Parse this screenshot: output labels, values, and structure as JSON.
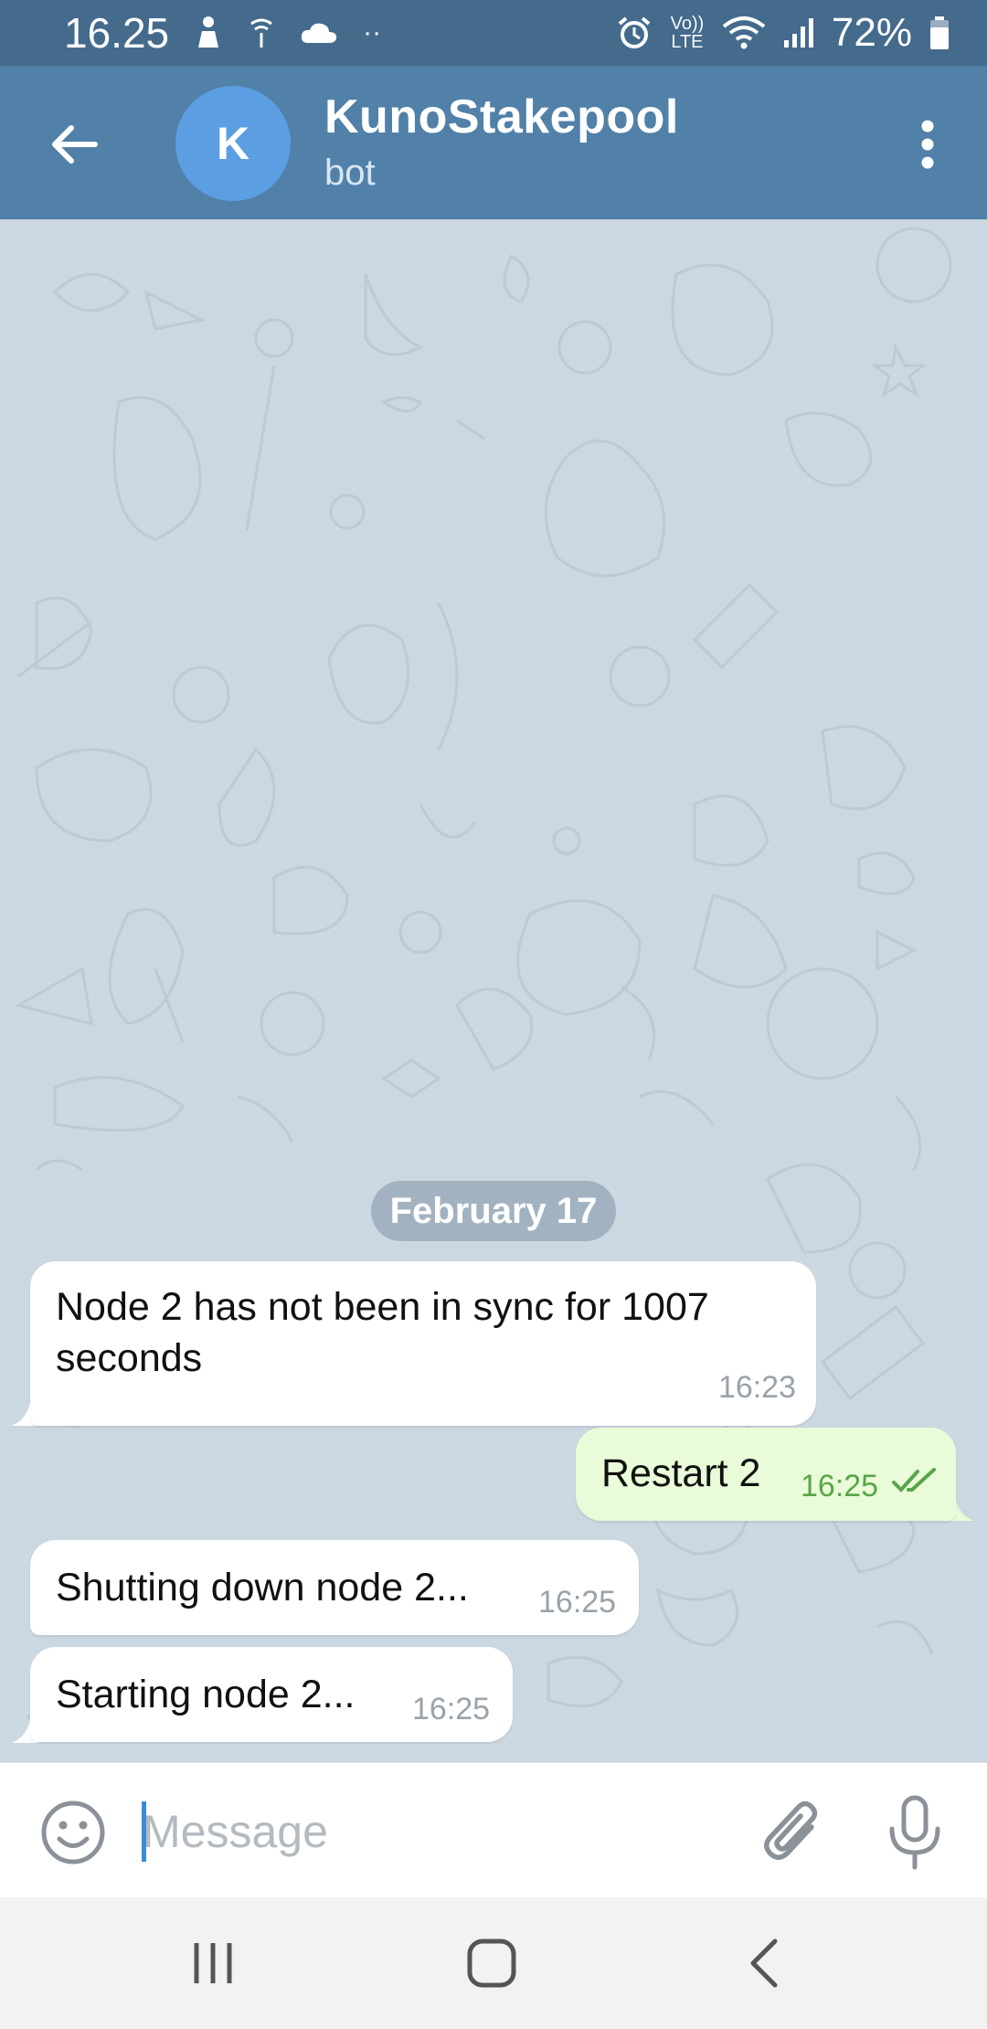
{
  "status_bar": {
    "time": "16.25",
    "notification_dots": "··",
    "volte_label": "Vo)) LTE",
    "battery": "72%"
  },
  "header": {
    "avatar_letter": "K",
    "title": "KunoStakepool",
    "subtitle": "bot"
  },
  "chat": {
    "date_separator": "February 17",
    "messages": [
      {
        "direction": "in",
        "text_line1": "Node 2 has not been in sync for 1007",
        "text_line2": "seconds",
        "time": "16:23"
      },
      {
        "direction": "out",
        "text": "Restart 2",
        "time": "16:25",
        "status": "read"
      },
      {
        "direction": "in",
        "text": "Shutting down node 2...",
        "time": "16:25"
      },
      {
        "direction": "in",
        "text": "Starting node 2...",
        "time": "16:25"
      }
    ]
  },
  "input": {
    "placeholder": "Message"
  },
  "colors": {
    "status_bar": "#446a8c",
    "header": "#5180a8",
    "avatar": "#5c9ee2",
    "outgoing_bubble": "#e9fbd8",
    "read_check": "#58a54a"
  },
  "icons": [
    "back-arrow-icon",
    "more-vert-icon",
    "emoji-icon",
    "attach-icon",
    "mic-icon",
    "double-check-icon"
  ]
}
